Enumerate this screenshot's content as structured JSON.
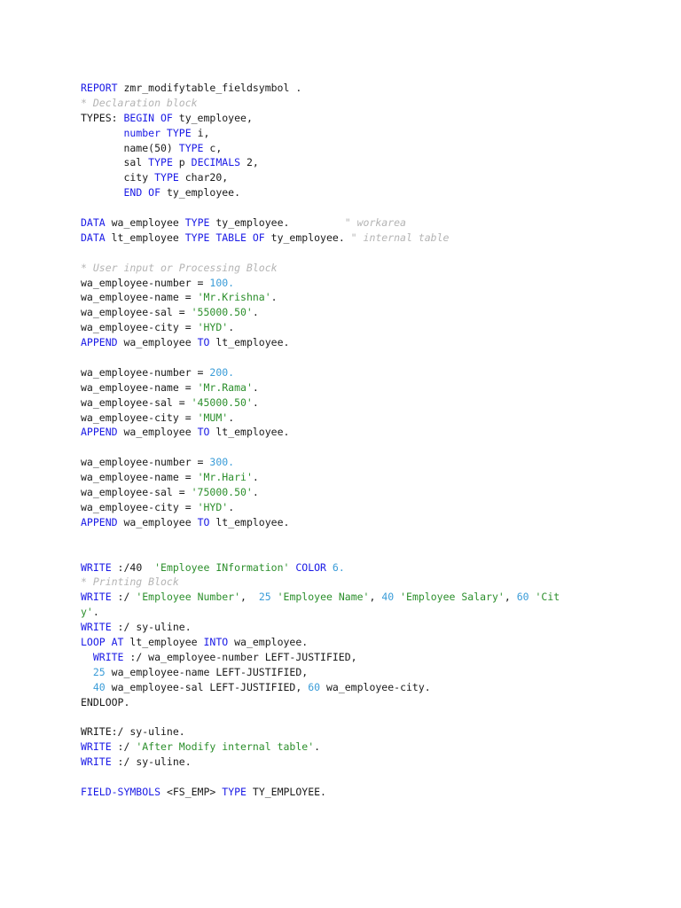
{
  "colors": {
    "keyword": "#1a1ae6",
    "number": "#3a9cd8",
    "string": "#2c8f2c",
    "comment": "#b4b4b4",
    "text": "#1a1a1a"
  },
  "lines": [
    [
      {
        "t": "kw",
        "v": "REPORT"
      },
      {
        "t": "txt",
        "v": " zmr_modifytable_fieldsymbol ."
      }
    ],
    [
      {
        "t": "cmt",
        "v": "* Declaration block"
      }
    ],
    [
      {
        "t": "txt",
        "v": "TYPES: "
      },
      {
        "t": "kw",
        "v": "BEGIN OF"
      },
      {
        "t": "txt",
        "v": " ty_employee,"
      }
    ],
    [
      {
        "t": "txt",
        "v": "       "
      },
      {
        "t": "kw",
        "v": "number TYPE"
      },
      {
        "t": "txt",
        "v": " i,"
      }
    ],
    [
      {
        "t": "txt",
        "v": "       name(50) "
      },
      {
        "t": "kw",
        "v": "TYPE"
      },
      {
        "t": "txt",
        "v": " c,"
      }
    ],
    [
      {
        "t": "txt",
        "v": "       sal "
      },
      {
        "t": "kw",
        "v": "TYPE"
      },
      {
        "t": "txt",
        "v": " p "
      },
      {
        "t": "kw",
        "v": "DECIMALS"
      },
      {
        "t": "txt",
        "v": " 2,"
      }
    ],
    [
      {
        "t": "txt",
        "v": "       city "
      },
      {
        "t": "kw",
        "v": "TYPE"
      },
      {
        "t": "txt",
        "v": " char20,"
      }
    ],
    [
      {
        "t": "txt",
        "v": "       "
      },
      {
        "t": "kw",
        "v": "END OF"
      },
      {
        "t": "txt",
        "v": " ty_employee."
      }
    ],
    [],
    [
      {
        "t": "kw",
        "v": "DATA"
      },
      {
        "t": "txt",
        "v": " wa_employee "
      },
      {
        "t": "kw",
        "v": "TYPE"
      },
      {
        "t": "txt",
        "v": " ty_employee.         "
      },
      {
        "t": "cmt",
        "v": "\" workarea"
      }
    ],
    [
      {
        "t": "kw",
        "v": "DATA"
      },
      {
        "t": "txt",
        "v": " lt_employee "
      },
      {
        "t": "kw",
        "v": "TYPE TABLE OF"
      },
      {
        "t": "txt",
        "v": " ty_employee. "
      },
      {
        "t": "cmt",
        "v": "\" internal table"
      }
    ],
    [],
    [
      {
        "t": "cmt",
        "v": "* User input or Processing Block"
      }
    ],
    [
      {
        "t": "txt",
        "v": "wa_employee-number = "
      },
      {
        "t": "num",
        "v": "100."
      }
    ],
    [
      {
        "t": "txt",
        "v": "wa_employee-name = "
      },
      {
        "t": "str",
        "v": "'Mr.Krishna'"
      },
      {
        "t": "txt",
        "v": "."
      }
    ],
    [
      {
        "t": "txt",
        "v": "wa_employee-sal = "
      },
      {
        "t": "str",
        "v": "'55000.50'"
      },
      {
        "t": "txt",
        "v": "."
      }
    ],
    [
      {
        "t": "txt",
        "v": "wa_employee-city = "
      },
      {
        "t": "str",
        "v": "'HYD'"
      },
      {
        "t": "txt",
        "v": "."
      }
    ],
    [
      {
        "t": "kw",
        "v": "APPEND"
      },
      {
        "t": "txt",
        "v": " wa_employee "
      },
      {
        "t": "kw",
        "v": "TO"
      },
      {
        "t": "txt",
        "v": " lt_employee."
      }
    ],
    [],
    [
      {
        "t": "txt",
        "v": "wa_employee-number = "
      },
      {
        "t": "num",
        "v": "200."
      }
    ],
    [
      {
        "t": "txt",
        "v": "wa_employee-name = "
      },
      {
        "t": "str",
        "v": "'Mr.Rama'"
      },
      {
        "t": "txt",
        "v": "."
      }
    ],
    [
      {
        "t": "txt",
        "v": "wa_employee-sal = "
      },
      {
        "t": "str",
        "v": "'45000.50'"
      },
      {
        "t": "txt",
        "v": "."
      }
    ],
    [
      {
        "t": "txt",
        "v": "wa_employee-city = "
      },
      {
        "t": "str",
        "v": "'MUM'"
      },
      {
        "t": "txt",
        "v": "."
      }
    ],
    [
      {
        "t": "kw",
        "v": "APPEND"
      },
      {
        "t": "txt",
        "v": " wa_employee "
      },
      {
        "t": "kw",
        "v": "TO"
      },
      {
        "t": "txt",
        "v": " lt_employee."
      }
    ],
    [],
    [
      {
        "t": "txt",
        "v": "wa_employee-number = "
      },
      {
        "t": "num",
        "v": "300."
      }
    ],
    [
      {
        "t": "txt",
        "v": "wa_employee-name = "
      },
      {
        "t": "str",
        "v": "'Mr.Hari'"
      },
      {
        "t": "txt",
        "v": "."
      }
    ],
    [
      {
        "t": "txt",
        "v": "wa_employee-sal = "
      },
      {
        "t": "str",
        "v": "'75000.50'"
      },
      {
        "t": "txt",
        "v": "."
      }
    ],
    [
      {
        "t": "txt",
        "v": "wa_employee-city = "
      },
      {
        "t": "str",
        "v": "'HYD'"
      },
      {
        "t": "txt",
        "v": "."
      }
    ],
    [
      {
        "t": "kw",
        "v": "APPEND"
      },
      {
        "t": "txt",
        "v": " wa_employee "
      },
      {
        "t": "kw",
        "v": "TO"
      },
      {
        "t": "txt",
        "v": " lt_employee."
      }
    ],
    [],
    [],
    [
      {
        "t": "kw",
        "v": "WRITE"
      },
      {
        "t": "txt",
        "v": " :/40  "
      },
      {
        "t": "str",
        "v": "'Employee INformation'"
      },
      {
        "t": "txt",
        "v": " "
      },
      {
        "t": "kw",
        "v": "COLOR"
      },
      {
        "t": "txt",
        "v": " "
      },
      {
        "t": "num",
        "v": "6."
      }
    ],
    [
      {
        "t": "cmt",
        "v": "* Printing Block"
      }
    ],
    [
      {
        "t": "kw",
        "v": "WRITE"
      },
      {
        "t": "txt",
        "v": " :/ "
      },
      {
        "t": "str",
        "v": "'Employee Number'"
      },
      {
        "t": "txt",
        "v": ",  "
      },
      {
        "t": "num",
        "v": "25"
      },
      {
        "t": "txt",
        "v": " "
      },
      {
        "t": "str",
        "v": "'Employee Name'"
      },
      {
        "t": "txt",
        "v": ", "
      },
      {
        "t": "num",
        "v": "40"
      },
      {
        "t": "txt",
        "v": " "
      },
      {
        "t": "str",
        "v": "'Employee Salary'"
      },
      {
        "t": "txt",
        "v": ", "
      },
      {
        "t": "num",
        "v": "60"
      },
      {
        "t": "txt",
        "v": " "
      },
      {
        "t": "str",
        "v": "'Cit"
      }
    ],
    [
      {
        "t": "str",
        "v": "y'"
      },
      {
        "t": "txt",
        "v": "."
      }
    ],
    [
      {
        "t": "kw",
        "v": "WRITE"
      },
      {
        "t": "txt",
        "v": " :/ sy-uline."
      }
    ],
    [
      {
        "t": "kw",
        "v": "LOOP AT"
      },
      {
        "t": "txt",
        "v": " lt_employee "
      },
      {
        "t": "kw",
        "v": "INTO"
      },
      {
        "t": "txt",
        "v": " wa_employee."
      }
    ],
    [
      {
        "t": "txt",
        "v": "  "
      },
      {
        "t": "kw",
        "v": "WRITE"
      },
      {
        "t": "txt",
        "v": " :/ wa_employee-number LEFT-JUSTIFIED,"
      }
    ],
    [
      {
        "t": "txt",
        "v": "  "
      },
      {
        "t": "num",
        "v": "25"
      },
      {
        "t": "txt",
        "v": " wa_employee-name LEFT-JUSTIFIED,"
      }
    ],
    [
      {
        "t": "txt",
        "v": "  "
      },
      {
        "t": "num",
        "v": "40"
      },
      {
        "t": "txt",
        "v": " wa_employee-sal LEFT-JUSTIFIED, "
      },
      {
        "t": "num",
        "v": "60"
      },
      {
        "t": "txt",
        "v": " wa_employee-city."
      }
    ],
    [
      {
        "t": "txt",
        "v": "ENDLOOP."
      }
    ],
    [],
    [
      {
        "t": "txt",
        "v": "WRITE:/ sy-uline."
      }
    ],
    [
      {
        "t": "kw",
        "v": "WRITE"
      },
      {
        "t": "txt",
        "v": " :/ "
      },
      {
        "t": "str",
        "v": "'After Modify internal table'"
      },
      {
        "t": "txt",
        "v": "."
      }
    ],
    [
      {
        "t": "kw",
        "v": "WRITE"
      },
      {
        "t": "txt",
        "v": " :/ sy-uline."
      }
    ],
    [],
    [
      {
        "t": "kw",
        "v": "FIELD-SYMBOLS"
      },
      {
        "t": "txt",
        "v": " <FS_EMP> "
      },
      {
        "t": "kw",
        "v": "TYPE"
      },
      {
        "t": "txt",
        "v": " TY_EMPLOYEE."
      }
    ]
  ]
}
